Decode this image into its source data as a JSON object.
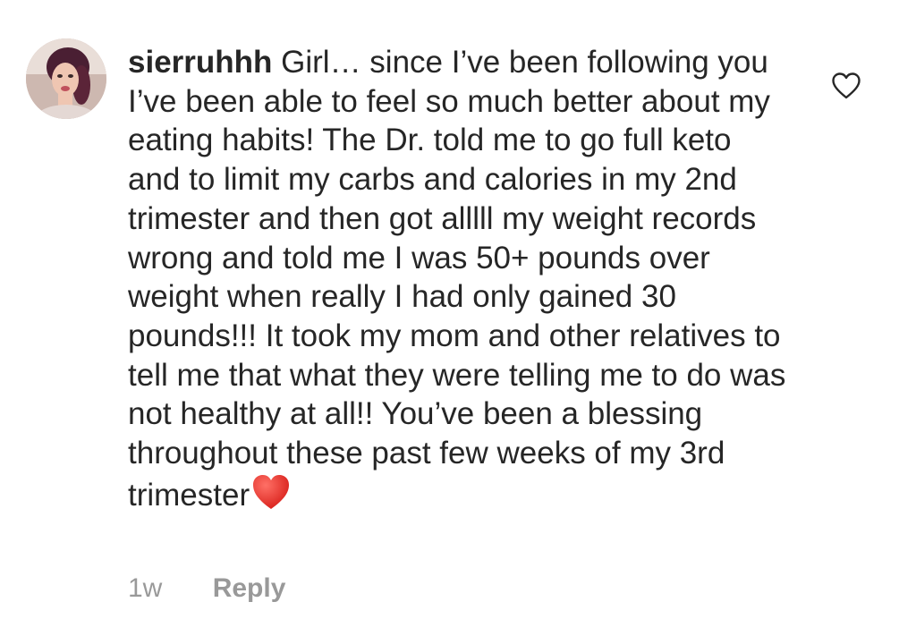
{
  "comment": {
    "username": "sierruhhh",
    "text": "Girl… since I’ve been following you I’ve been able to feel so much better about my eating habits! The Dr. told me to go full keto and to limit my carbs and calories in my 2nd trimester and then got alllll my weight records wrong and told me I was 50+ pounds over weight when really I had only gained 30 pounds!!! It took my mom and other relatives to tell me that what they were telling me to do was not healthy at all!! You’ve been a blessing throughout these past few weeks of my 3rd trimester",
    "emoji": "red-heart",
    "timestamp": "1w",
    "reply_label": "Reply"
  },
  "icons": {
    "like": "heart-outline-icon",
    "avatar": "profile-photo"
  },
  "colors": {
    "text": "#262626",
    "meta": "#999999",
    "heart_outline": "#262626",
    "emoji_heart": "#e8362d"
  }
}
